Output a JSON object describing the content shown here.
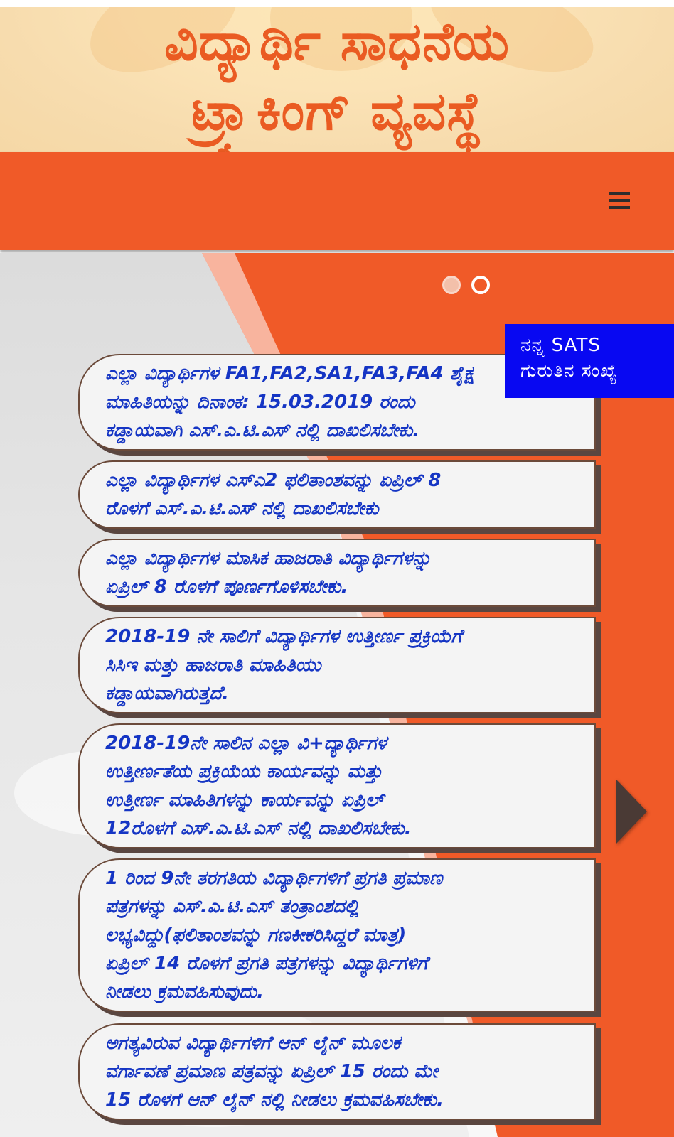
{
  "header": {
    "title_line1": "ವಿದ್ಯಾರ್ಥಿ ಸಾಧನೆಯ",
    "title_line2": "ಟ್ರ್ಯಾಕಿಂಗ್ ವ್ಯವಸ್ಥೆ",
    "title_color": "#ea5b22"
  },
  "navbar": {
    "color": "#f05a28",
    "menu_icon": "hamburger-menu-icon"
  },
  "slider": {
    "dots": [
      "active",
      "inactive"
    ],
    "next_icon": "chevron-right-icon"
  },
  "sats_badge": {
    "line1": "ನನ್ನ SATS",
    "line2": "ಗುರುತಿನ ಸಂಖ್ಯೆ",
    "color": "#0808f2"
  },
  "notices": [
    {
      "lines": [
        "ಎಲ್ಲಾ ವಿದ್ಯಾರ್ಥಿಗಳ FA1,FA2,SA1,FA3,FA4 ಶೈಕ್ಷ",
        "ಮಾಹಿತಿಯನ್ನು ದಿನಾಂಕ: 15.03.2019 ರಂದು",
        "ಕಡ್ಡಾಯವಾಗಿ ಎಸ್.ಎ.ಟಿ.ಎಸ್ ನಲ್ಲಿ ದಾಖಲಿಸಬೇಕು."
      ]
    },
    {
      "lines": [
        "ಎಲ್ಲಾ ವಿದ್ಯಾರ್ಥಿಗಳ ಎಸ್ಎ2 ಫಲಿತಾಂಶವನ್ನು ಏಪ್ರಿಲ್ 8",
        "ರೊಳಗೆ ಎಸ್.ಎ.ಟಿ.ಎಸ್ ನಲ್ಲಿ ದಾಖಲಿಸಬೇಕು"
      ]
    },
    {
      "lines": [
        "ಎಲ್ಲಾ ವಿದ್ಯಾರ್ಥಿಗಳ ಮಾಸಿಕ ಹಾಜರಾತಿ ವಿದ್ಯಾರ್ಥಿಗಳನ್ನು",
        "ಏಪ್ರಿಲ್ 8 ರೊಳಗೆ ಪೂರ್ಣಗೊಳಿಸಬೇಕು."
      ]
    },
    {
      "lines": [
        "2018-19 ನೇ ಸಾಲಿಗೆ ವಿದ್ಯಾರ್ಥಿಗಳ ಉತ್ತೀರ್ಣ ಪ್ರಕ್ರಿಯೆಗೆ",
        "ಸಿಸಿಇ ಮತ್ತು ಹಾಜರಾತಿ ಮಾಹಿತಿಯು",
        "ಕಡ್ಡಾಯವಾಗಿರುತ್ತದೆ."
      ]
    },
    {
      "lines": [
        "2018-19ನೇ ಸಾಲಿನ ಎಲ್ಲಾ ವಿ+ದ್ಯಾರ್ಥಿಗಳ",
        "ಉತ್ತೀರ್ಣತೆಯ ಪ್ರಕ್ರಿಯೆಯ ಕಾರ್ಯವನ್ನು ಮತ್ತು",
        "ಉತ್ತೀರ್ಣ ಮಾಹಿತಿಗಳನ್ನು ಕಾರ್ಯವನ್ನು ಏಪ್ರಿಲ್",
        "12ರೊಳಗೆ ಎಸ್.ಎ.ಟಿ.ಎಸ್ ನಲ್ಲಿ ದಾಖಲಿಸಬೇಕು."
      ]
    },
    {
      "lines": [
        "1 ರಿಂದ 9ನೇ ತರಗತಿಯ ವಿದ್ಯಾರ್ಥಿಗಳಿಗೆ ಪ್ರಗತಿ ಪ್ರಮಾಣ",
        "ಪತ್ರಗಳನ್ನು ಎಸ್.ಎ.ಟಿ.ಎಸ್ ತಂತ್ರಾಂಶದಲ್ಲಿ",
        "ಲಭ್ಯವಿದ್ದು(ಫಲಿತಾಂಶವನ್ನು ಗಣಕೀಕರಿಸಿದ್ದರೆ ಮಾತ್ರ)",
        "ಏಪ್ರಿಲ್ 14 ರೊಳಗೆ ಪ್ರಗತಿ ಪತ್ರಗಳನ್ನು ವಿದ್ಯಾರ್ಥಿಗಳಿಗೆ",
        "ನೀಡಲು ಕ್ರಮವಹಿಸುವುದು."
      ]
    },
    {
      "lines": [
        "ಅಗತ್ಯವಿರುವ ವಿದ್ಯಾರ್ಥಿಗಳಿಗೆ ಆನ್ ಲೈನ್ ಮೂಲಕ",
        "ವರ್ಗಾವಣೆ ಪ್ರಮಾಣ ಪತ್ರವನ್ನು ಏಪ್ರಿಲ್ 15 ರಂದು ಮೇ",
        "15 ರೊಳಗೆ ಆನ್ ಲೈನ್ ನಲ್ಲಿ ನೀಡಲು ಕ್ರಮವಹಿಸಬೇಕು."
      ]
    }
  ]
}
